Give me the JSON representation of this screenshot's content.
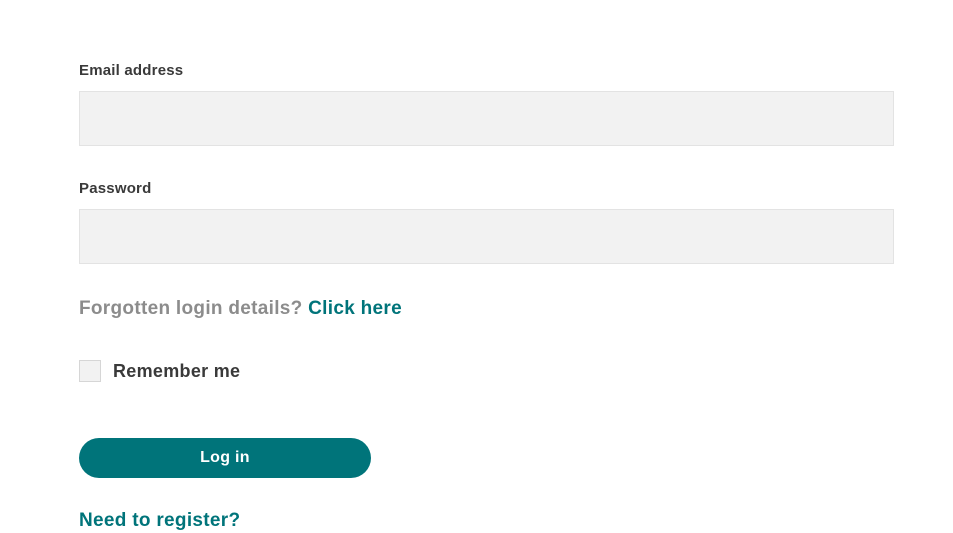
{
  "form": {
    "email_label": "Email address",
    "email_value": "",
    "password_label": "Password",
    "password_value": "",
    "forgotten_text": "Forgotten login details? ",
    "forgotten_link": "Click here",
    "remember_label": "Remember me",
    "remember_checked": false,
    "login_button": "Log in",
    "register_link": "Need to register?"
  },
  "colors": {
    "accent": "#00747a",
    "input_bg": "#f2f2f2",
    "muted_text": "#8c8c8c",
    "text": "#3a3a3a"
  }
}
